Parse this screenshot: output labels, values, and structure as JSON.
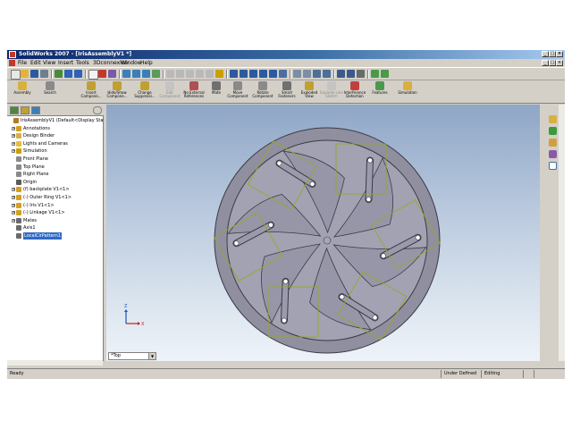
{
  "window": {
    "title": "SolidWorks 2007 - [IrisAssemblyV1 *]"
  },
  "menu": [
    "File",
    "Edit",
    "View",
    "Insert",
    "Tools",
    "3Dconnexion",
    "Window",
    "Help"
  ],
  "commands": [
    {
      "label": "Assembly",
      "disabled": false
    },
    {
      "label": "Search",
      "disabled": false
    },
    {
      "label": "Insert Compone...",
      "disabled": false
    },
    {
      "label": "Hide/Show Compone...",
      "disabled": false
    },
    {
      "label": "Change Suppressi...",
      "disabled": false
    },
    {
      "label": "Edit Component",
      "disabled": true
    },
    {
      "label": "No External References",
      "disabled": false
    },
    {
      "label": "Mate",
      "disabled": false
    },
    {
      "label": "Move Component",
      "disabled": false
    },
    {
      "label": "Rotate Component",
      "disabled": false
    },
    {
      "label": "Smart Fasteners",
      "disabled": false
    },
    {
      "label": "Exploded View",
      "disabled": false
    },
    {
      "label": "Explode Line Sketch",
      "disabled": true
    },
    {
      "label": "Interference Detection",
      "disabled": false
    },
    {
      "label": "Features",
      "disabled": false
    },
    {
      "label": "Simulation",
      "disabled": false
    }
  ],
  "tree": [
    {
      "label": "IrisAssemblyV1 (Default<Display Stat",
      "indent": 0,
      "expander": "",
      "icon": "assembly-icon",
      "color": "#b07a2a"
    },
    {
      "label": "Annotations",
      "indent": 1,
      "expander": "+",
      "icon": "annotations-icon",
      "color": "#d4a020"
    },
    {
      "label": "Design Binder",
      "indent": 1,
      "expander": "+",
      "icon": "design-binder-icon",
      "color": "#d9b040"
    },
    {
      "label": "Lights and Cameras",
      "indent": 1,
      "expander": "+",
      "icon": "lights-icon",
      "color": "#e0c040"
    },
    {
      "label": "Simulation",
      "indent": 1,
      "expander": "+",
      "icon": "simulation-icon",
      "color": "#c9a000"
    },
    {
      "label": "Front Plane",
      "indent": 1,
      "expander": "",
      "icon": "plane-icon",
      "color": "#8a8a8a"
    },
    {
      "label": "Top Plane",
      "indent": 1,
      "expander": "",
      "icon": "plane-icon",
      "color": "#8a8a8a"
    },
    {
      "label": "Right Plane",
      "indent": 1,
      "expander": "",
      "icon": "plane-icon",
      "color": "#8a8a8a"
    },
    {
      "label": "Origin",
      "indent": 1,
      "expander": "",
      "icon": "origin-icon",
      "color": "#5a5a5a"
    },
    {
      "label": "(f) backplate V1<1>",
      "indent": 1,
      "expander": "+",
      "icon": "part-icon",
      "color": "#d4a020"
    },
    {
      "label": "(-) Outer Ring V1<1>",
      "indent": 1,
      "expander": "+",
      "icon": "part-icon",
      "color": "#d4a020"
    },
    {
      "label": "(-) Iris V1<1>",
      "indent": 1,
      "expander": "+",
      "icon": "part-icon",
      "color": "#d4a020"
    },
    {
      "label": "(-) Linkage V1<1>",
      "indent": 1,
      "expander": "+",
      "icon": "part-icon",
      "color": "#d4a020"
    },
    {
      "label": "Mates",
      "indent": 1,
      "expander": "+",
      "icon": "mates-icon",
      "color": "#6a6a6a"
    },
    {
      "label": "Axis1",
      "indent": 1,
      "expander": "",
      "icon": "axis-icon",
      "color": "#6a6a6a"
    },
    {
      "label": "LocalCirPattern1",
      "indent": 1,
      "expander": "",
      "icon": "pattern-icon",
      "color": "#6a6a6a",
      "selected": true
    }
  ],
  "viewport": {
    "view_orientation": "*Top",
    "triad_labels": [
      "X",
      "Z"
    ]
  },
  "status": {
    "left": "Ready",
    "state": "Under Defined",
    "mode": "Editing Assembly"
  },
  "colors": {
    "part_gray": "#8e8e9e",
    "edge": "#3a3a46",
    "selection_box": "#9aa81a",
    "accent": "#316ac5"
  }
}
